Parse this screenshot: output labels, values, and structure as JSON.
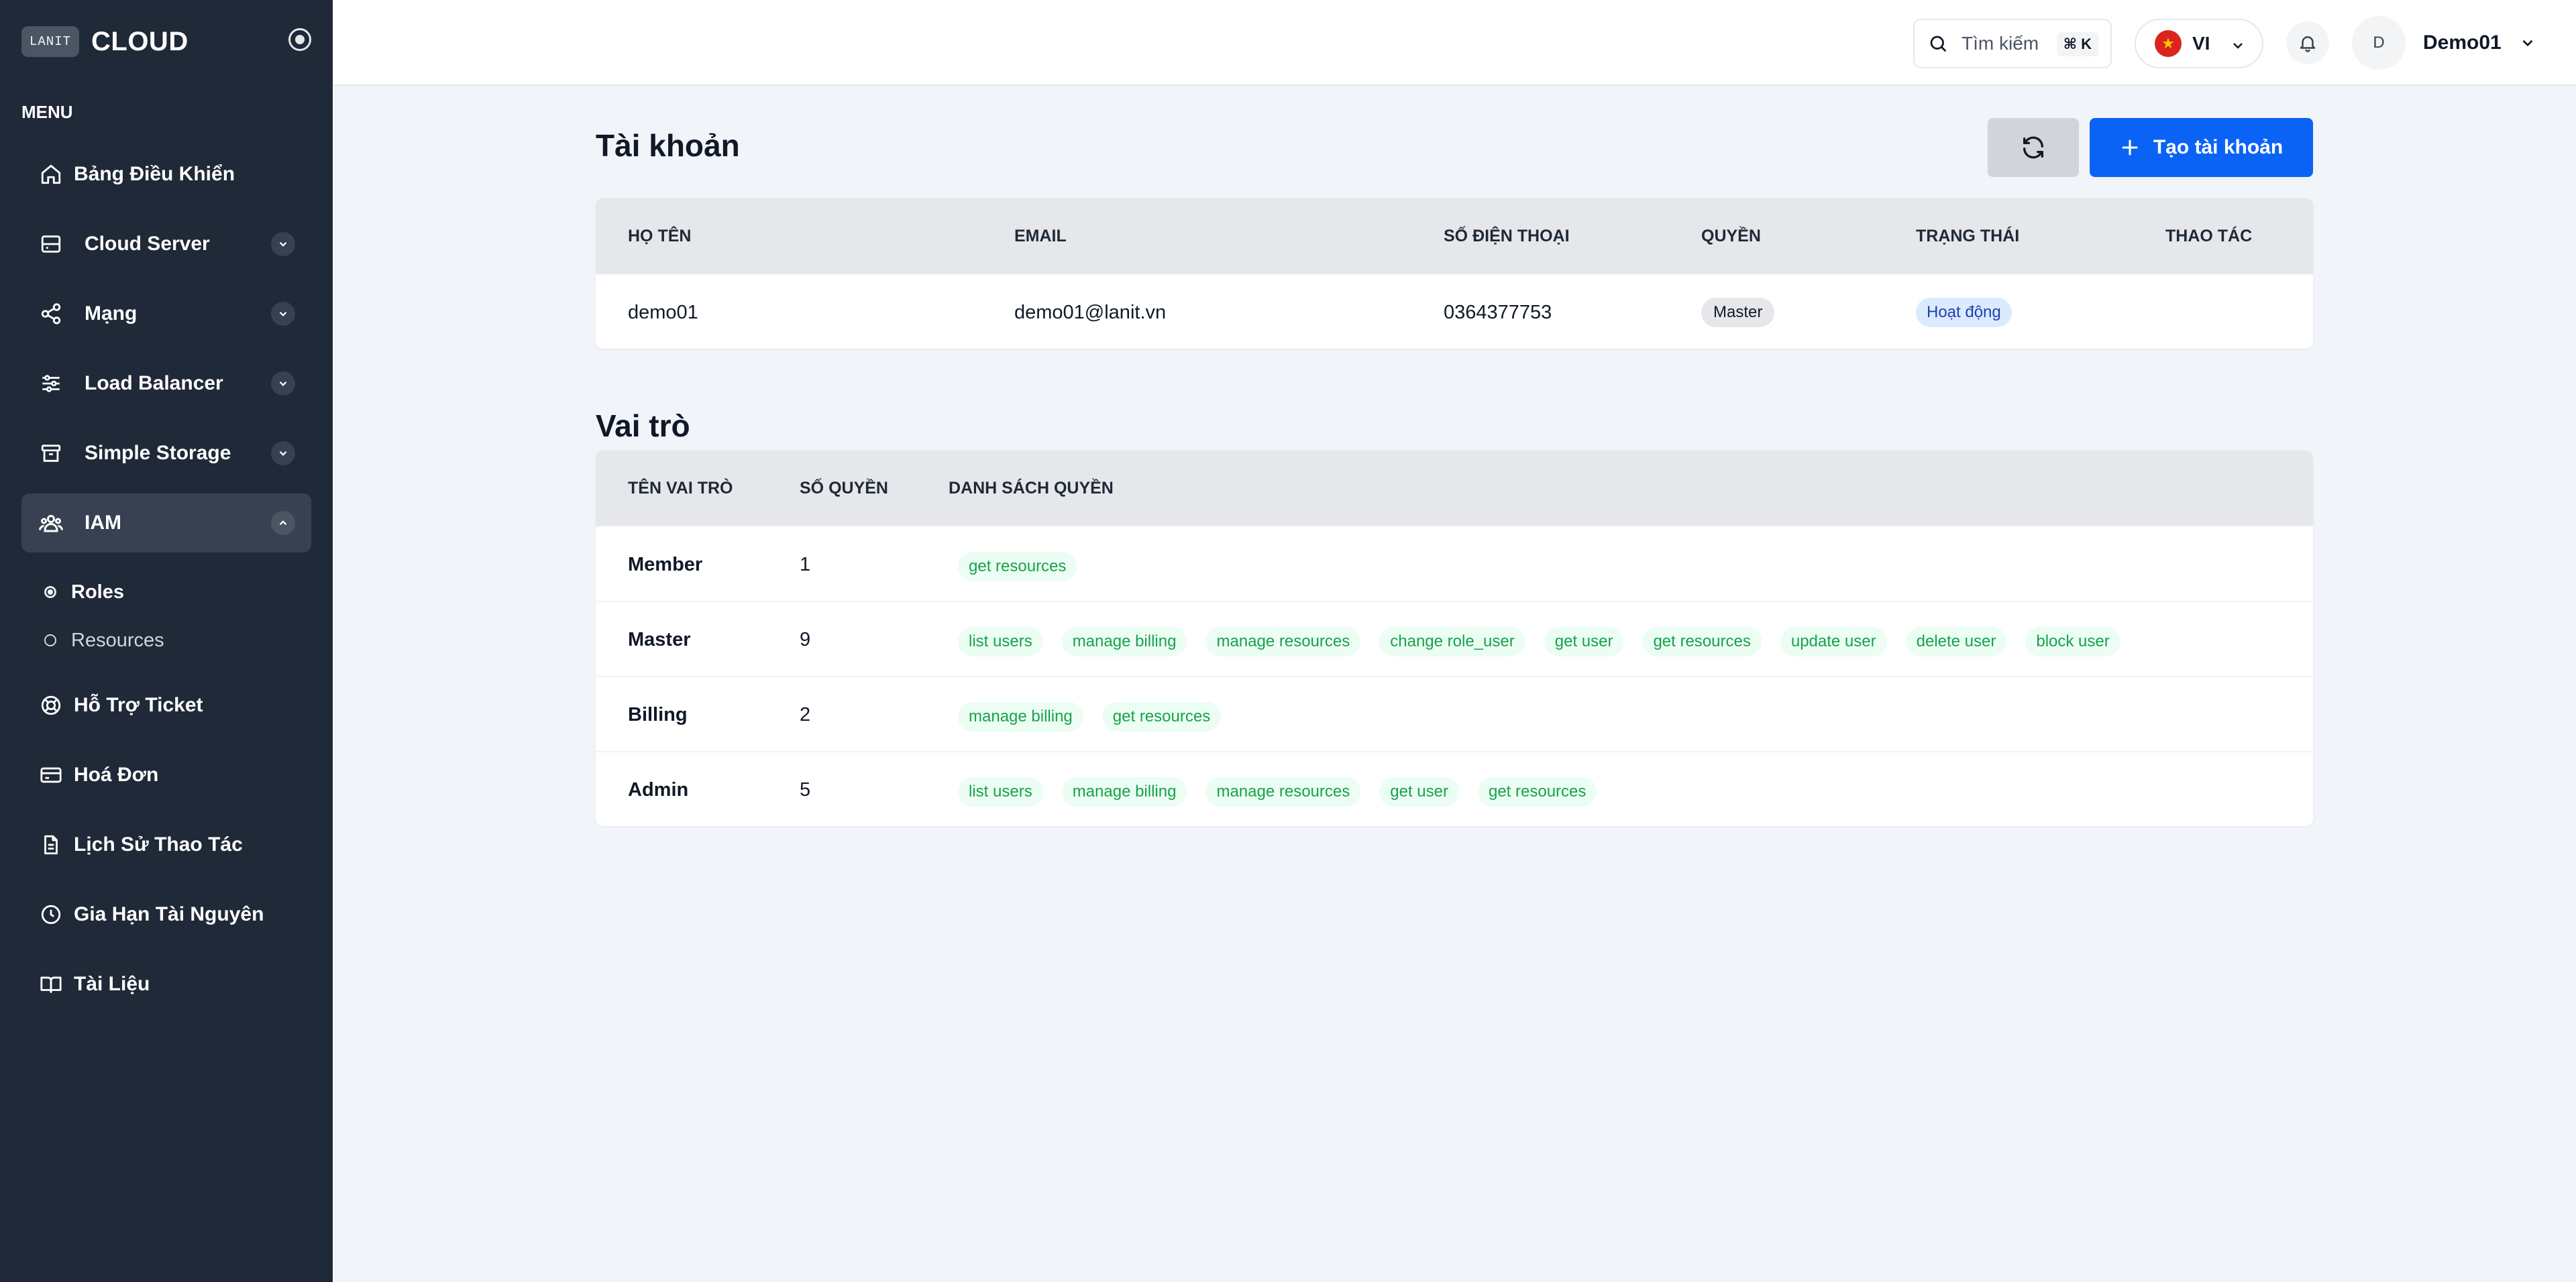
{
  "brand": {
    "logo_text": "LANIT",
    "name": "CLOUD"
  },
  "sidebar": {
    "menu_label": "MENU",
    "items": [
      {
        "label": "Bảng Điều Khiển",
        "icon": "home-icon"
      },
      {
        "label": "Cloud Server",
        "icon": "server-icon"
      },
      {
        "label": "Mạng",
        "icon": "share-icon"
      },
      {
        "label": "Load Balancer",
        "icon": "sliders-icon"
      },
      {
        "label": "Simple Storage",
        "icon": "archive-icon"
      },
      {
        "label": "IAM",
        "icon": "users-icon"
      },
      {
        "label": "Hỗ Trợ Ticket",
        "icon": "lifebuoy-icon"
      },
      {
        "label": "Hoá Đơn",
        "icon": "credit-card-icon"
      },
      {
        "label": "Lịch Sử Thao Tác",
        "icon": "file-text-icon"
      },
      {
        "label": "Gia Hạn Tài Nguyên",
        "icon": "clock-icon"
      },
      {
        "label": "Tài Liệu",
        "icon": "book-icon"
      }
    ],
    "iam_sub": [
      {
        "label": "Roles",
        "active": true
      },
      {
        "label": "Resources",
        "active": false
      }
    ]
  },
  "header": {
    "search_placeholder": "Tìm kiếm",
    "search_shortcut": "⌘ K",
    "language": "VI",
    "user_initial": "D",
    "user_name": "Demo01"
  },
  "accounts": {
    "title": "Tài khoản",
    "create_label": "Tạo tài khoản",
    "columns": [
      "HỌ TÊN",
      "EMAIL",
      "SỐ ĐIỆN THOẠI",
      "QUYỀN",
      "TRẠNG THÁI",
      "THAO TÁC"
    ],
    "rows": [
      {
        "name": "demo01",
        "email": "demo01@lanit.vn",
        "phone": "0364377753",
        "role": "Master",
        "status": "Hoạt động"
      }
    ]
  },
  "roles": {
    "title": "Vai trò",
    "columns": [
      "TÊN VAI TRÒ",
      "SỐ QUYỀN",
      "DANH SÁCH QUYỀN"
    ],
    "rows": [
      {
        "name": "Member",
        "count": "1",
        "permissions": [
          "get resources"
        ]
      },
      {
        "name": "Master",
        "count": "9",
        "permissions": [
          "list users",
          "manage billing",
          "manage resources",
          "change role_user",
          "get user",
          "get resources",
          "update user",
          "delete user",
          "block user"
        ]
      },
      {
        "name": "Billing",
        "count": "2",
        "permissions": [
          "manage billing",
          "get resources"
        ]
      },
      {
        "name": "Admin",
        "count": "5",
        "permissions": [
          "list users",
          "manage billing",
          "manage resources",
          "get user",
          "get resources"
        ]
      }
    ]
  },
  "colors": {
    "sidebar_bg": "#1f2937",
    "primary": "#0b63f6",
    "perm_text": "#16a34a",
    "perm_bg": "#ecfdf3"
  }
}
